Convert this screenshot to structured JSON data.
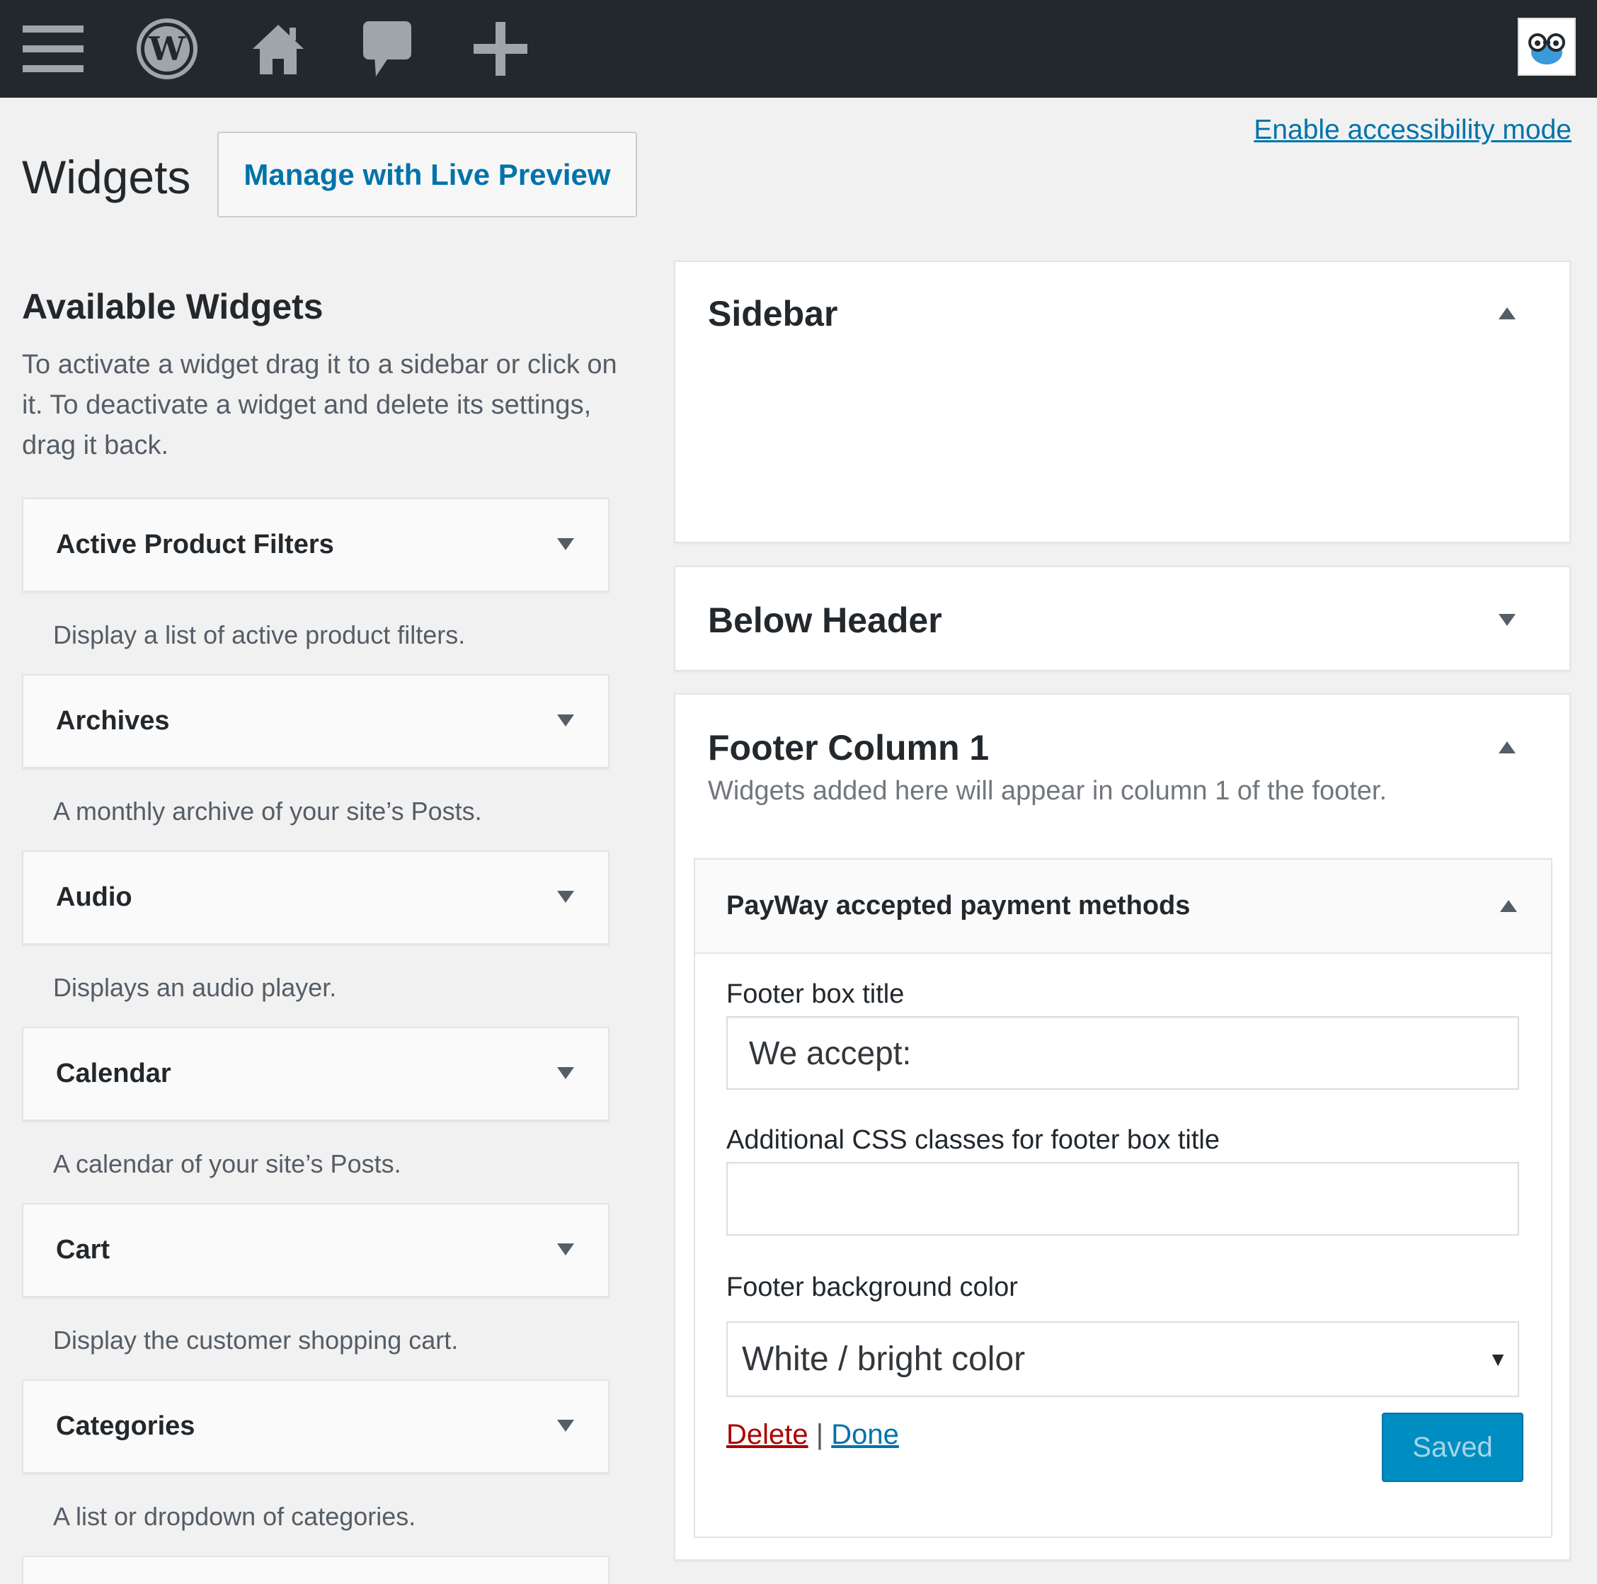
{
  "header": {
    "title": "Widgets",
    "live_preview_label": "Manage with Live Preview",
    "accessibility_link": "Enable accessibility mode"
  },
  "adminbar": {
    "icons": [
      "menu-icon",
      "wordpress-logo-icon",
      "home-icon",
      "comment-icon",
      "plus-icon"
    ],
    "avatar": "user-avatar"
  },
  "available": {
    "title": "Available Widgets",
    "description": "To activate a widget drag it to a sidebar or click on it. To deactivate a widget and delete its settings, drag it back.",
    "widgets": [
      {
        "name": "Active Product Filters",
        "desc": "Display a list of active product filters."
      },
      {
        "name": "Archives",
        "desc": "A monthly archive of your site’s Posts."
      },
      {
        "name": "Audio",
        "desc": "Displays an audio player."
      },
      {
        "name": "Calendar",
        "desc": "A calendar of your site’s Posts."
      },
      {
        "name": "Cart",
        "desc": "Display the customer shopping cart."
      },
      {
        "name": "Categories",
        "desc": "A list or dropdown of categories."
      }
    ]
  },
  "areas": {
    "sidebar": {
      "title": "Sidebar"
    },
    "below_header": {
      "title": "Below Header"
    },
    "footer1": {
      "title": "Footer Column 1",
      "description": "Widgets added here will appear in column 1 of the footer.",
      "widget": {
        "title": "PayWay accepted payment methods",
        "field_title_label": "Footer box title",
        "field_title_value": "We accept:",
        "field_css_label": "Additional CSS classes for footer box title",
        "field_css_value": "",
        "field_bg_label": "Footer background color",
        "field_bg_value": "White / bright color",
        "delete_label": "Delete",
        "separator": "|",
        "done_label": "Done",
        "saved_label": "Saved"
      }
    }
  },
  "colors": {
    "adminbar": "#23282d",
    "accent": "#0073aa",
    "delete": "#aa0000",
    "button_primary": "#008ec2"
  }
}
